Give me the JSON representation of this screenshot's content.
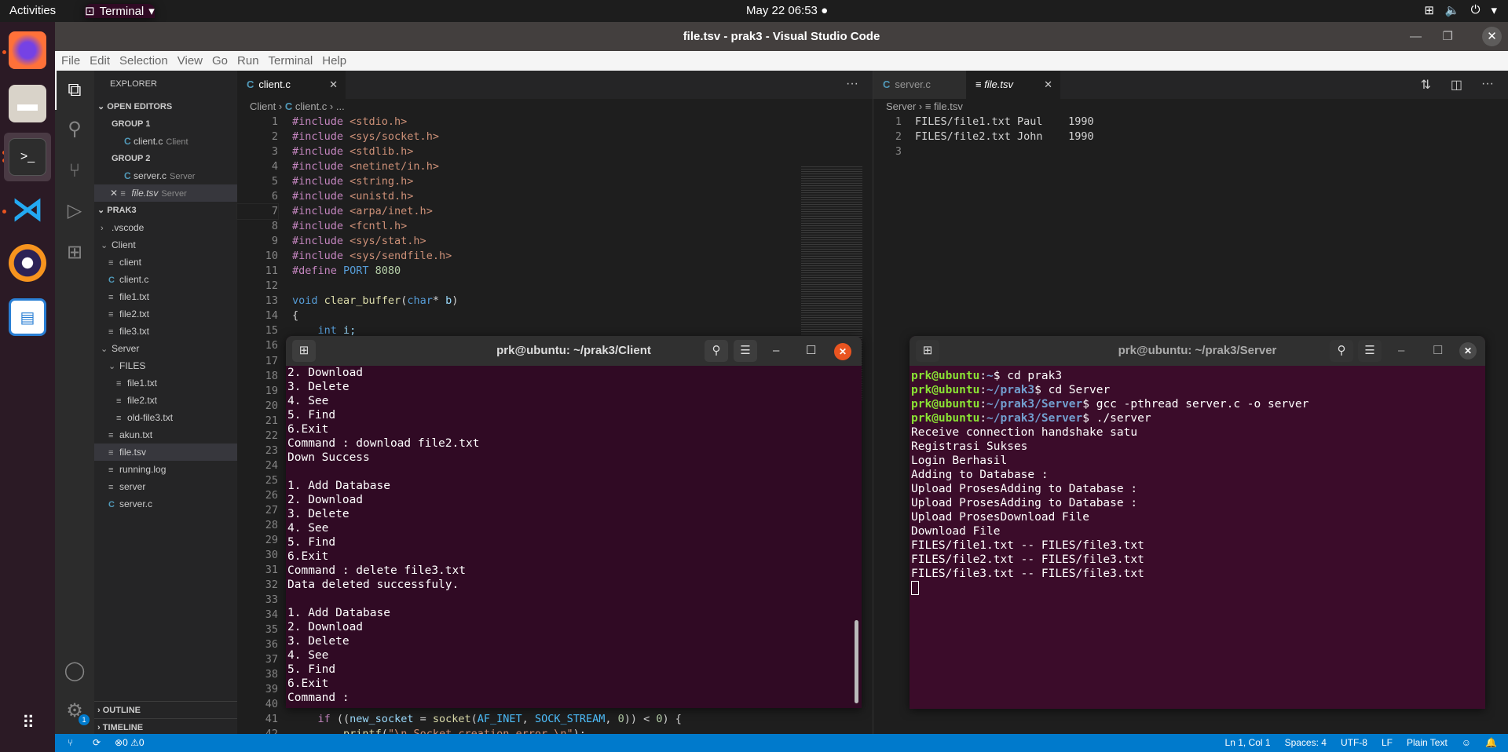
{
  "topbar": {
    "activities": "Activities",
    "app": "Terminal",
    "clock": "May 22  06:53"
  },
  "dock": {
    "apps": [
      "firefox",
      "files",
      "terminal",
      "vscode",
      "eclipse",
      "libreoffice-writer"
    ]
  },
  "window": {
    "title": "file.tsv - prak3 - Visual Studio Code"
  },
  "menu": [
    "File",
    "Edit",
    "Selection",
    "View",
    "Go",
    "Run",
    "Terminal",
    "Help"
  ],
  "sidebar": {
    "title": "EXPLORER",
    "open_editors": "OPEN EDITORS",
    "group1": "GROUP 1",
    "group2": "GROUP 2",
    "oe": [
      {
        "name": "client.c",
        "desc": "Client"
      },
      {
        "name": "server.c",
        "desc": "Server"
      },
      {
        "name": "file.tsv",
        "desc": "Server"
      }
    ],
    "project": "PRAK3",
    "tree": [
      {
        "name": ".vscode",
        "type": "folder-closed",
        "depth": 1
      },
      {
        "name": "Client",
        "type": "folder-open",
        "depth": 1
      },
      {
        "name": "client",
        "type": "file",
        "depth": 2
      },
      {
        "name": "client.c",
        "type": "c",
        "depth": 2
      },
      {
        "name": "file1.txt",
        "type": "file",
        "depth": 2
      },
      {
        "name": "file2.txt",
        "type": "file",
        "depth": 2
      },
      {
        "name": "file3.txt",
        "type": "file",
        "depth": 2
      },
      {
        "name": "Server",
        "type": "folder-open",
        "depth": 1
      },
      {
        "name": "FILES",
        "type": "folder-open",
        "depth": 2
      },
      {
        "name": "file1.txt",
        "type": "file",
        "depth": 3
      },
      {
        "name": "file2.txt",
        "type": "file",
        "depth": 3
      },
      {
        "name": "old-file3.txt",
        "type": "file",
        "depth": 3
      },
      {
        "name": "akun.txt",
        "type": "file",
        "depth": 2
      },
      {
        "name": "file.tsv",
        "type": "file",
        "depth": 2,
        "selected": true
      },
      {
        "name": "running.log",
        "type": "file",
        "depth": 2
      },
      {
        "name": "server",
        "type": "file",
        "depth": 2
      },
      {
        "name": "server.c",
        "type": "c",
        "depth": 2
      }
    ],
    "outline": "OUTLINE",
    "timeline": "TIMELINE"
  },
  "editor1": {
    "tab": "client.c",
    "crumb": [
      "Client",
      "client.c",
      "..."
    ],
    "lines": [
      [
        [
          "#include ",
          "k"
        ],
        [
          "<stdio.h>",
          "s"
        ]
      ],
      [
        [
          "#include ",
          "k"
        ],
        [
          "<sys/socket.h>",
          "s"
        ]
      ],
      [
        [
          "#include ",
          "k"
        ],
        [
          "<stdlib.h>",
          "s"
        ]
      ],
      [
        [
          "#include ",
          "k"
        ],
        [
          "<netinet/in.h>",
          "s"
        ]
      ],
      [
        [
          "#include ",
          "k"
        ],
        [
          "<string.h>",
          "s"
        ]
      ],
      [
        [
          "#include ",
          "k"
        ],
        [
          "<unistd.h>",
          "s"
        ]
      ],
      [
        [
          "#include ",
          "k"
        ],
        [
          "<arpa/inet.h>",
          "s"
        ]
      ],
      [
        [
          "#include ",
          "k"
        ],
        [
          "<fcntl.h>",
          "s"
        ]
      ],
      [
        [
          "#include ",
          "k"
        ],
        [
          "<sys/stat.h>",
          "s"
        ]
      ],
      [
        [
          "#include ",
          "k"
        ],
        [
          "<sys/sendfile.h>",
          "s"
        ]
      ],
      [
        [
          "#define ",
          "k"
        ],
        [
          "PORT ",
          "b"
        ],
        [
          "8080",
          "n"
        ]
      ],
      [],
      [
        [
          "void ",
          "b"
        ],
        [
          "clear_buffer",
          "f"
        ],
        [
          "(",
          "p"
        ],
        [
          "char",
          "b"
        ],
        [
          "* ",
          "p"
        ],
        [
          "b",
          "v"
        ],
        [
          ")",
          "p"
        ]
      ],
      [
        [
          "{",
          "p"
        ]
      ],
      [
        [
          "    int ",
          "b"
        ],
        [
          "i;",
          "v"
        ]
      ],
      [],
      [],
      [],
      [],
      [],
      [],
      [],
      [],
      [],
      [],
      [],
      [],
      [],
      [],
      [],
      [],
      [],
      [],
      [],
      [],
      [],
      [],
      [],
      [],
      [],
      [
        [
          "    if ",
          "k"
        ],
        [
          "((",
          "p"
        ],
        [
          "new_socket",
          "v"
        ],
        [
          " = ",
          "p"
        ],
        [
          "socket",
          "f"
        ],
        [
          "(",
          "p"
        ],
        [
          "AF_INET",
          "m"
        ],
        [
          ", ",
          "p"
        ],
        [
          "SOCK_STREAM",
          "m"
        ],
        [
          ", ",
          "p"
        ],
        [
          "0",
          "n"
        ],
        [
          ")) < ",
          "p"
        ],
        [
          "0",
          "n"
        ],
        [
          ") {",
          "p"
        ]
      ],
      [
        [
          "        printf",
          "f"
        ],
        [
          "(",
          "p"
        ],
        [
          "\"\\n Socket creation error \\n\"",
          "s"
        ],
        [
          ");",
          "p"
        ]
      ]
    ]
  },
  "editor2": {
    "tabs": [
      "server.c",
      "file.tsv"
    ],
    "crumb": [
      "Server",
      "file.tsv"
    ],
    "lines": [
      "FILES/file1.txt Paul    1990",
      "FILES/file2.txt John    1990",
      ""
    ]
  },
  "term_client": {
    "title": "prk@ubuntu: ~/prak3/Client",
    "lines": [
      "2. Download",
      "3. Delete",
      "4. See",
      "5. Find",
      "6.Exit",
      "Command : download file2.txt",
      "Down Success",
      "",
      "1. Add Database",
      "2. Download",
      "3. Delete",
      "4. See",
      "5. Find",
      "6.Exit",
      "Command : delete file3.txt",
      "Data deleted successfuly.",
      "",
      "1. Add Database",
      "2. Download",
      "3. Delete",
      "4. See",
      "5. Find",
      "6.Exit",
      "Command : "
    ]
  },
  "term_server": {
    "title": "prk@ubuntu: ~/prak3/Server",
    "prompts": [
      {
        "user": "prk@ubuntu",
        "path": "~",
        "cmd": "$ cd prak3"
      },
      {
        "user": "prk@ubuntu",
        "path": "~/prak3",
        "cmd": "$ cd Server"
      },
      {
        "user": "prk@ubuntu",
        "path": "~/prak3/Server",
        "cmd": "$ gcc -pthread server.c -o server"
      },
      {
        "user": "prk@ubuntu",
        "path": "~/prak3/Server",
        "cmd": "$ ./server"
      }
    ],
    "lines": [
      "Receive connection handshake satu",
      "Registrasi Sukses",
      "Login Berhasil",
      "Adding to Database :",
      "Upload ProsesAdding to Database :",
      "Upload ProsesAdding to Database :",
      "Upload ProsesDownload File",
      "Download File",
      "FILES/file1.txt -- FILES/file3.txt",
      "FILES/file2.txt -- FILES/file3.txt",
      "FILES/file3.txt -- FILES/file3.txt"
    ]
  },
  "status": {
    "problems": "0",
    "warnings": "0",
    "position": "Ln 1, Col 1",
    "spaces": "Spaces: 4",
    "encoding": "UTF-8",
    "eol": "LF",
    "language": "Plain Text",
    "settings_badge": "1"
  },
  "colors": {
    "status": "#007acc",
    "terminal_bg": "#300a24",
    "accent": "#e95420"
  }
}
